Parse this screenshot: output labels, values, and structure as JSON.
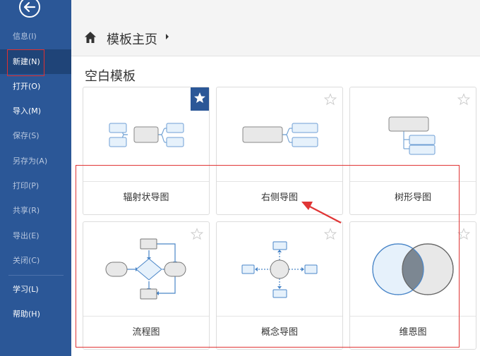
{
  "sidebar": {
    "items": [
      {
        "label": "信息(I)",
        "dim": true
      },
      {
        "label": "新建(N)",
        "dim": false,
        "active": true
      },
      {
        "label": "打开(O)",
        "dim": false
      },
      {
        "label": "导入(M)",
        "dim": false
      },
      {
        "label": "保存(S)",
        "dim": true
      },
      {
        "label": "另存为(A)",
        "dim": true
      },
      {
        "label": "打印(P)",
        "dim": true
      },
      {
        "label": "共享(R)",
        "dim": true
      },
      {
        "label": "导出(E)",
        "dim": true
      },
      {
        "label": "关闭(C)",
        "dim": true
      },
      {
        "label": "学习(L)",
        "dim": false
      },
      {
        "label": "帮助(H)",
        "dim": false
      }
    ]
  },
  "header": {
    "title": "模板主页"
  },
  "section": {
    "title": "空白模板"
  },
  "cards": [
    {
      "label": "辐射状导图",
      "favorite": true
    },
    {
      "label": "右侧导图",
      "favorite": false
    },
    {
      "label": "树形导图",
      "favorite": false
    },
    {
      "label": "流程图",
      "favorite": false
    },
    {
      "label": "概念导图",
      "favorite": false
    },
    {
      "label": "维恩图",
      "favorite": false
    }
  ],
  "colors": {
    "sidebar": "#2b5797",
    "sidebar_active": "#1f4478",
    "accent": "#2b5797",
    "highlight": "#e03035",
    "node_fill": "#e8e8e8",
    "node_blue": "#e6f1fb"
  },
  "icons": {
    "back": "back-arrow-icon",
    "home": "home-icon",
    "caret": "caret-right-icon",
    "star": "star-icon"
  }
}
